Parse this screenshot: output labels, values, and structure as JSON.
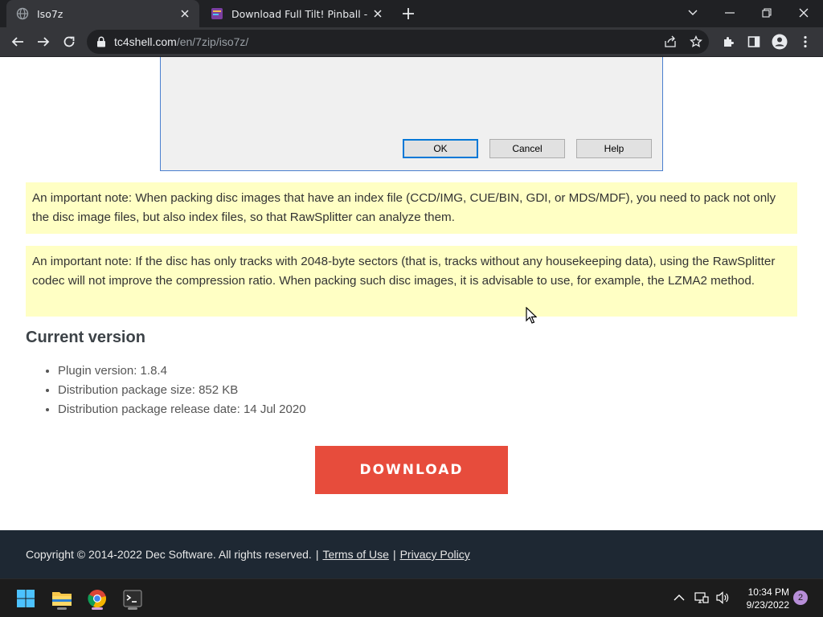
{
  "browser": {
    "tabs": [
      {
        "title": "Iso7z",
        "active": true,
        "favicon": "globe-icon"
      },
      {
        "title": "Download Full Tilt! Pinball - My A",
        "active": false,
        "favicon": "site-favicon-icon"
      }
    ],
    "url_host": "tc4shell.com",
    "url_path": "/en/7zip/iso7z/"
  },
  "dialog": {
    "ok_label": "OK",
    "cancel_label": "Cancel",
    "help_label": "Help"
  },
  "notes": [
    "An important note: When packing disc images that have an index file (CCD/IMG, CUE/BIN, GDI, or MDS/MDF), you need to pack not only the disc image files, but also index files, so that RawSplitter can analyze them.",
    "An important note: If the disc has only tracks with 2048-byte sectors (that is, tracks without any housekeeping data), using the RawSplitter codec will not improve the compression ratio. When packing such disc images, it is advisable to use, for example, the LZMA2 method."
  ],
  "current_version": {
    "heading": "Current version",
    "items": [
      "Plugin version: 1.8.4",
      "Distribution package size: 852 KB",
      "Distribution package release date: 14 Jul 2020"
    ]
  },
  "download_label": "DOWNLOAD",
  "footer": {
    "copyright": "Copyright © 2014-2022 Dec Software. All rights reserved.",
    "separator": "|",
    "terms": "Terms of Use",
    "privacy": "Privacy Policy"
  },
  "taskbar": {
    "time": "10:34 PM",
    "date": "9/23/2022",
    "notifications": "2"
  },
  "colors": {
    "note_bg": "#ffffc4",
    "download_bg": "#e74c3c",
    "footer_bg": "#1e2833"
  }
}
